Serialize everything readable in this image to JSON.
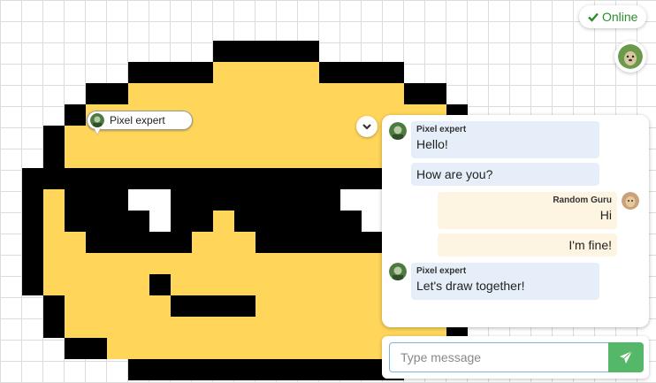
{
  "status": {
    "label": "Online",
    "color": "#2e8b2e"
  },
  "cursor": {
    "user": "Pixel expert"
  },
  "chat": {
    "messages": [
      {
        "author": "Pixel expert",
        "text": "Hello!",
        "side": "them"
      },
      {
        "author": "",
        "text": "How are you?",
        "side": "them"
      },
      {
        "author": "Random Guru",
        "text": "Hi",
        "side": "me"
      },
      {
        "author": "",
        "text": "I'm fine!",
        "side": "me"
      },
      {
        "author": "Pixel expert",
        "text": "Let's draw together!",
        "side": "them"
      }
    ]
  },
  "composer": {
    "placeholder": "Type message"
  },
  "colors": {
    "accent": "#55b768",
    "face": "#ffd55a",
    "outline": "#000000",
    "white": "#ffffff",
    "them_bubble": "#e6eff9",
    "me_bubble": "#fdf4e1"
  }
}
